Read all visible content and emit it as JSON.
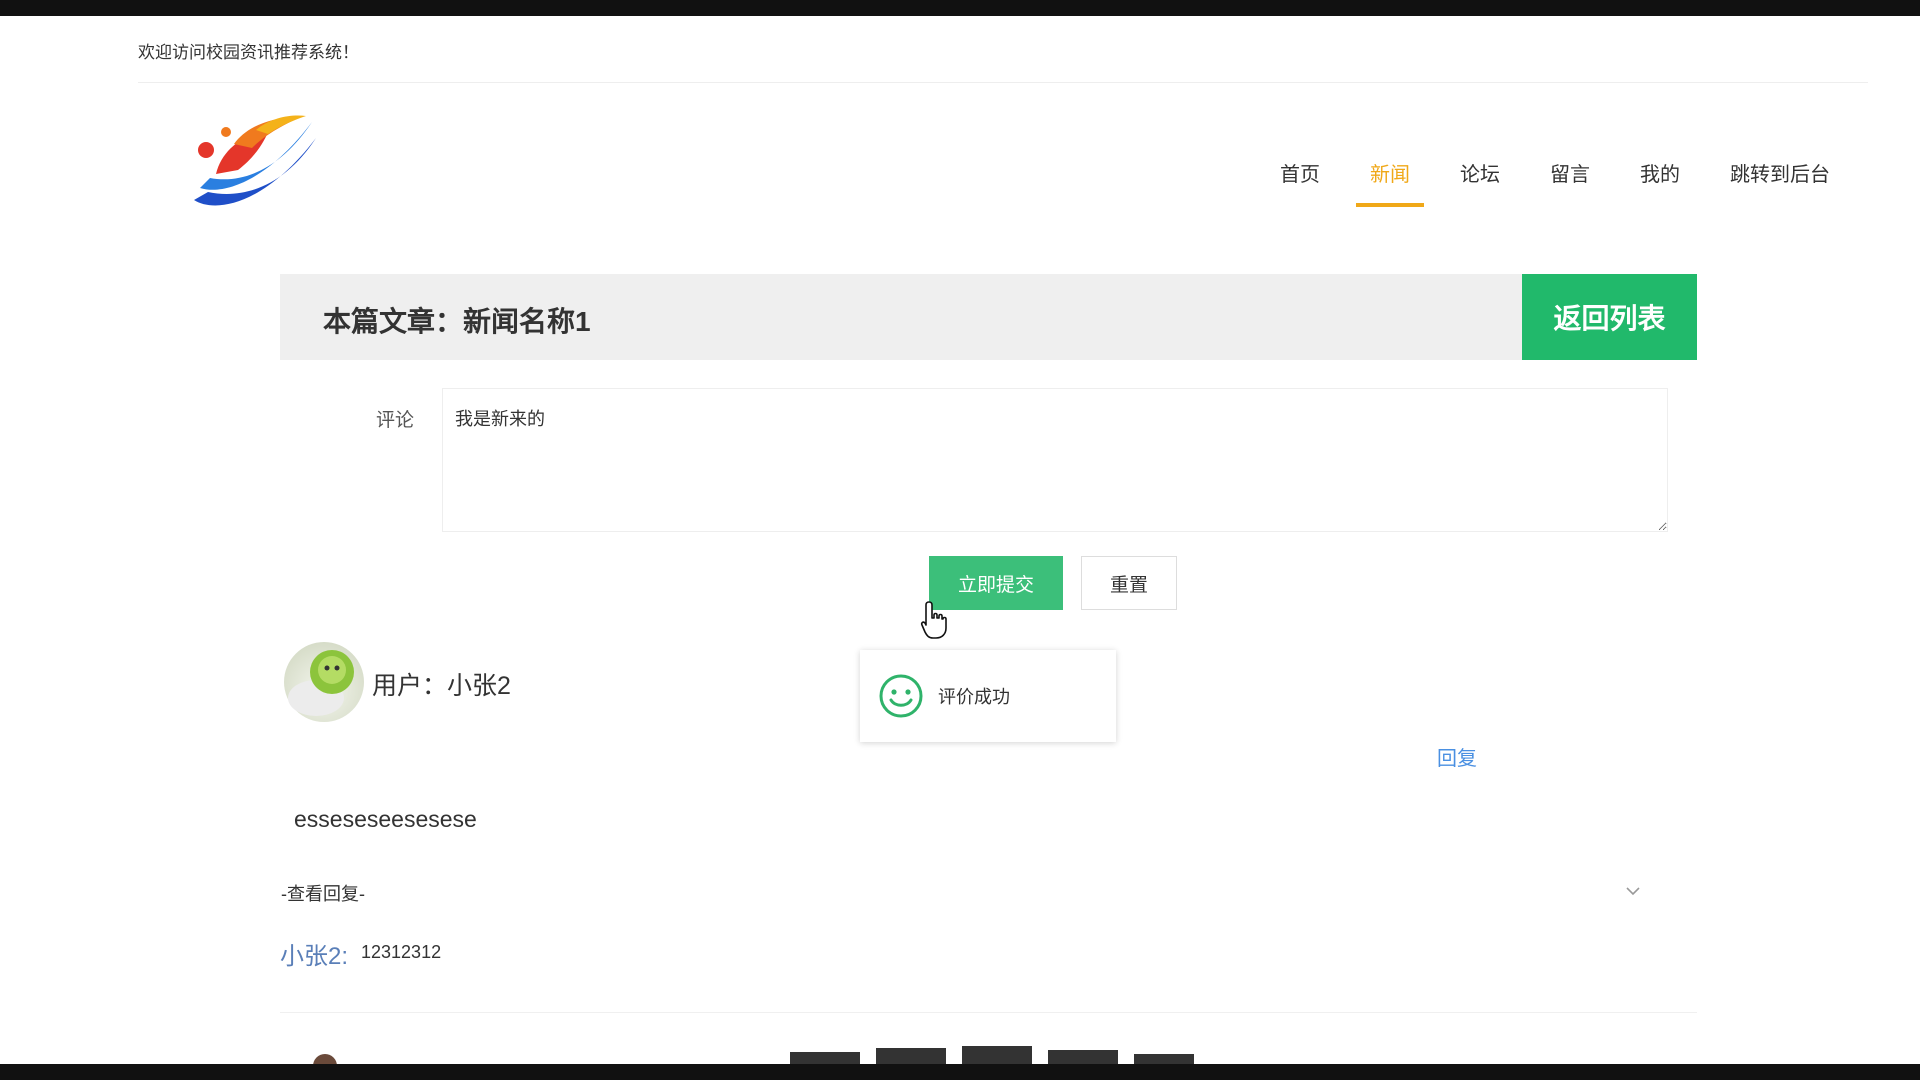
{
  "header": {
    "welcome_text": "欢迎访问校园资讯推荐系统！"
  },
  "nav": {
    "items": [
      {
        "label": "首页",
        "active": false
      },
      {
        "label": "新闻",
        "active": true
      },
      {
        "label": "论坛",
        "active": false
      },
      {
        "label": "留言",
        "active": false
      },
      {
        "label": "我的",
        "active": false
      },
      {
        "label": "跳转到后台",
        "active": false
      }
    ]
  },
  "article": {
    "title": "本篇文章：新闻名称1",
    "back_label": "返回列表"
  },
  "comment_form": {
    "label": "评论",
    "value": "我是新来的",
    "submit_label": "立即提交",
    "reset_label": "重置"
  },
  "toast": {
    "message": "评价成功",
    "icon": "smile-icon"
  },
  "comment": {
    "user_label": "用户：小张2",
    "reply_label": "回复",
    "content": "esseseseesesese",
    "view_replies_label": "-查看回复-",
    "replies": [
      {
        "user": "小张2:",
        "text": "12312312"
      }
    ]
  },
  "colors": {
    "accent_orange": "#f0a818",
    "brand_green": "#21b96b",
    "submit_green": "#3cbf7a",
    "link_blue": "#4a90e2",
    "reply_user_blue": "#5a7fb8"
  }
}
